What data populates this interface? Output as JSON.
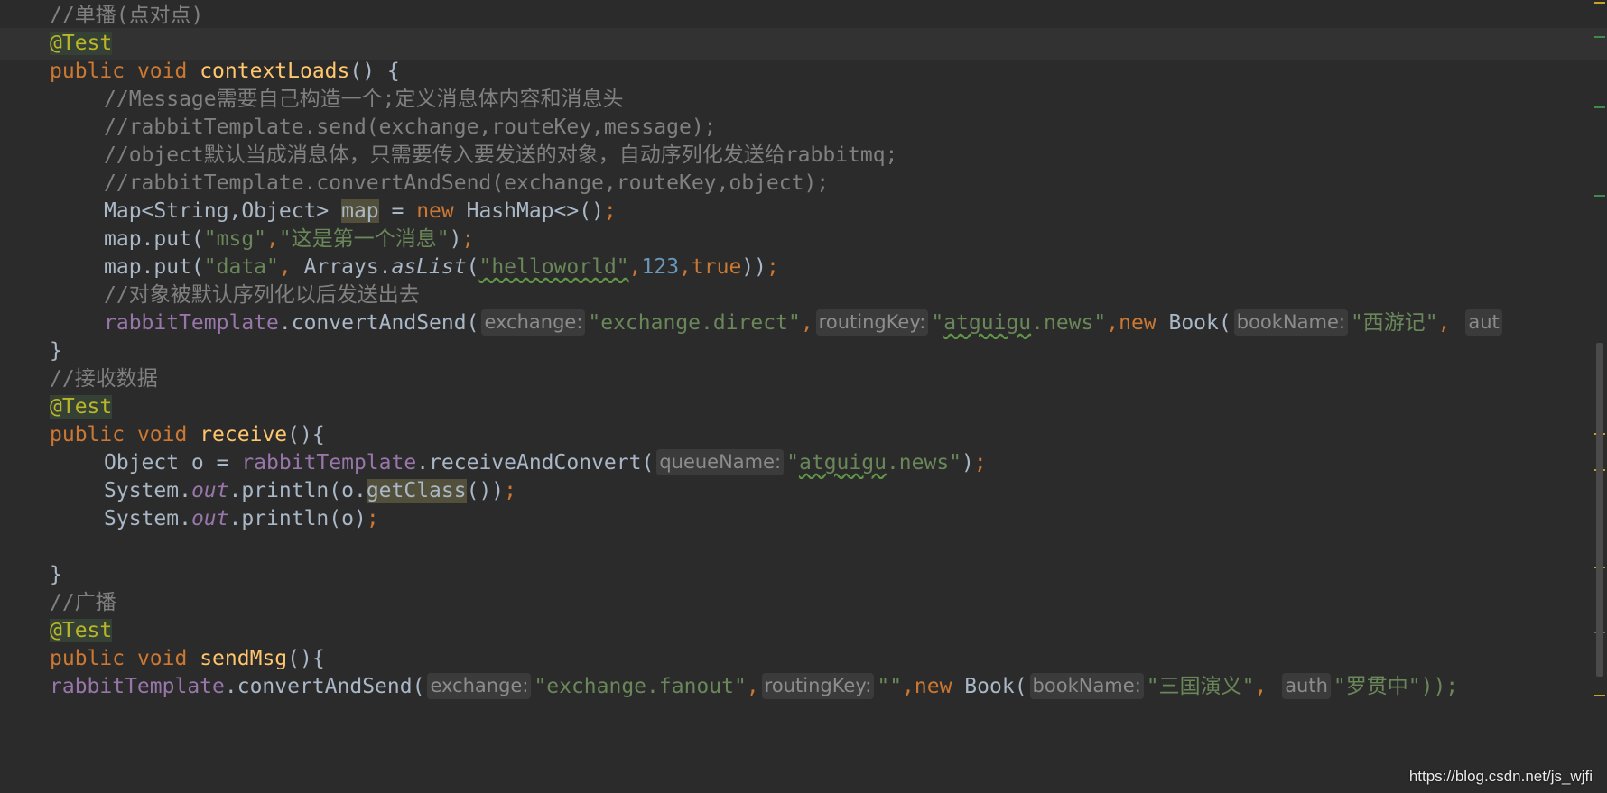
{
  "code": {
    "l1_comment": "//单播(点对点)",
    "annotation": "@Test",
    "kw_public": "public",
    "kw_void": "void",
    "kw_new": "new",
    "kw_true": "true",
    "method_contextLoads": "contextLoads",
    "method_receive": "receive",
    "method_sendMsg": "sendMsg",
    "c_message": "//Message需要自己构造一个;定义消息体内容和消息头",
    "c_send": "//rabbitTemplate.send(exchange,routeKey,message);",
    "c_object": "//object默认当成消息体，只需要传入要发送的对象，自动序列化发送给rabbitmq;",
    "c_convert": "//rabbitTemplate.convertAndSend(exchange,routeKey,object);",
    "c_serialize": "//对象被默认序列化以后发送出去",
    "c_receive": "//接收数据",
    "c_broadcast": "//广播",
    "map_decl_type": "Map<String,Object> ",
    "map_var": "map",
    "map_decl_rest": " = ",
    "hashmap_ctor": " HashMap<>()",
    "map_put": "map.put(",
    "str_msg": "\"msg\"",
    "str_msg_value": "\"这是第一个消息\"",
    "str_data": "\"data\"",
    "arrays": " Arrays.",
    "aslist": "asList",
    "str_helloworld": "\"helloworld\"",
    "num_123": "123",
    "rabbitTemplate": "rabbitTemplate",
    "convertAndSend": ".convertAndSend(",
    "hint_exchange": "exchange:",
    "hint_routingKey": "routingKey:",
    "hint_bookName": "bookName:",
    "hint_queueName": "queueName:",
    "hint_author_cut": "aut",
    "hint_author_cut2": "auth",
    "str_exchange_direct": "\"exchange.direct\"",
    "str_atguigu_news": "\"atguigu.news\"",
    "book": " Book(",
    "str_xiyouji": "\"西游记\"",
    "object_o": "Object o = ",
    "receiveAndConvert": ".receiveAndConvert(",
    "system": "System.",
    "out": "out",
    "println_o": ".println(o.",
    "getClass": "getClass",
    "println_o2": ".println(o)",
    "str_exchange_fanout": "\"exchange.fanout\"",
    "str_empty": "\"\"",
    "str_sanguo": "\"三国演义\"",
    "str_tail_cut": "\"罗贯中\"));"
  },
  "watermark": "https://blog.csdn.net/js_wjfi"
}
